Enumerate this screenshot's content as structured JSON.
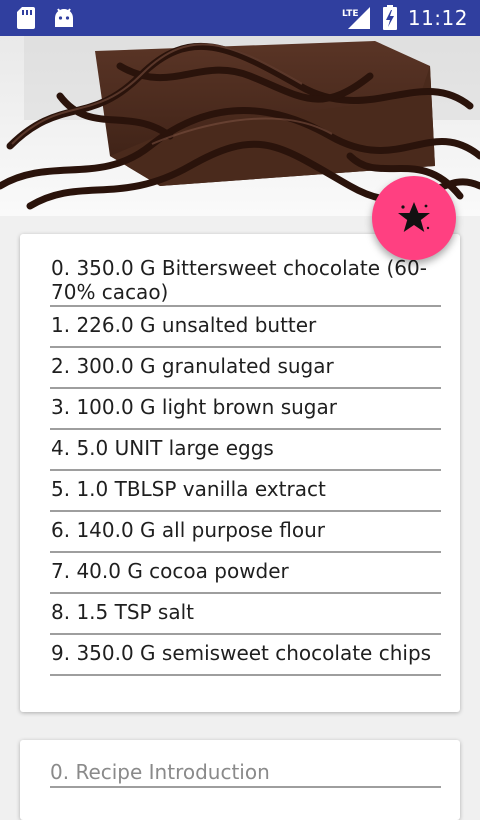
{
  "status_bar": {
    "time": "11:12",
    "network": "LTE",
    "left_icons": [
      "sd-card-icon",
      "android-icon"
    ],
    "right_icons": [
      "lte-signal-icon",
      "battery-charging-icon"
    ]
  },
  "header": {
    "image": "chocolate-brownie-photo"
  },
  "fab": {
    "icon": "star-icon",
    "color": "#ff4081"
  },
  "ingredients": [
    {
      "text": "0. 350.0 G  Bittersweet chocolate (60-70% cacao)"
    },
    {
      "text": "1. 226.0 G  unsalted butter"
    },
    {
      "text": "2. 300.0 G  granulated sugar"
    },
    {
      "text": "3. 100.0 G  light brown sugar"
    },
    {
      "text": "4. 5.0 UNIT  large eggs"
    },
    {
      "text": "5. 1.0 TBLSP  vanilla extract"
    },
    {
      "text": "6. 140.0 G  all purpose flour"
    },
    {
      "text": "7. 40.0 G  cocoa powder"
    },
    {
      "text": "8. 1.5 TSP  salt"
    },
    {
      "text": "9. 350.0 G  semisweet chocolate chips"
    }
  ],
  "steps": [
    {
      "text": "0. Recipe Introduction"
    }
  ],
  "colors": {
    "status_bar": "#303f9f",
    "accent": "#ff4081",
    "background": "#f0f0f0",
    "card": "#ffffff",
    "divider": "#9e9e9e"
  }
}
